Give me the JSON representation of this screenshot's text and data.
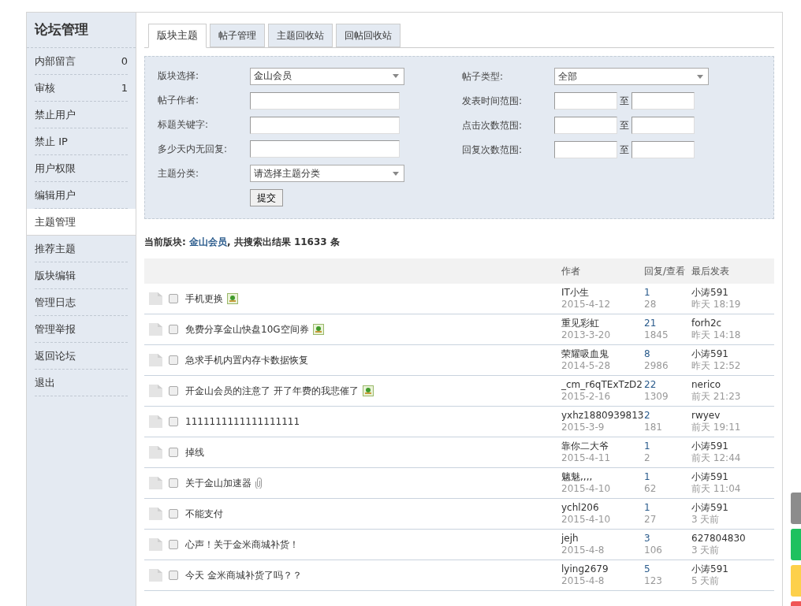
{
  "sidebar": {
    "title": "论坛管理",
    "items": [
      {
        "label": "内部留言",
        "count": "0",
        "selected": false
      },
      {
        "label": "审核",
        "count": "1",
        "selected": false
      },
      {
        "label": "禁止用户",
        "selected": false
      },
      {
        "label": "禁止 IP",
        "selected": false
      },
      {
        "label": "用户权限",
        "selected": false
      },
      {
        "label": "编辑用户",
        "selected": false
      },
      {
        "label": "主题管理",
        "selected": true
      },
      {
        "label": "推荐主题",
        "selected": false
      },
      {
        "label": "版块编辑",
        "selected": false
      },
      {
        "label": "管理日志",
        "selected": false
      },
      {
        "label": "管理举报",
        "selected": false
      },
      {
        "label": "返回论坛",
        "selected": false
      },
      {
        "label": "退出",
        "selected": false
      }
    ]
  },
  "tabs": [
    {
      "label": "版块主题",
      "selected": true
    },
    {
      "label": "帖子管理",
      "selected": false
    },
    {
      "label": "主题回收站",
      "selected": false
    },
    {
      "label": "回帖回收站",
      "selected": false
    }
  ],
  "filters": {
    "left": [
      {
        "label": "版块选择:",
        "kind": "select",
        "value": "金山会员"
      },
      {
        "label": "帖子作者:",
        "kind": "input"
      },
      {
        "label": "标题关键字:",
        "kind": "input"
      },
      {
        "label": "多少天内无回复:",
        "kind": "input"
      },
      {
        "label": "主题分类:",
        "kind": "select",
        "value": "请选择主题分类"
      }
    ],
    "right": [
      {
        "label": "帖子类型:",
        "kind": "select",
        "value": "全部"
      },
      {
        "label": "发表时间范围:",
        "kind": "range",
        "separator": "至"
      },
      {
        "label": "点击次数范围:",
        "kind": "range",
        "separator": "至"
      },
      {
        "label": "回复次数范围:",
        "kind": "range",
        "separator": "至"
      }
    ],
    "submit": "提交"
  },
  "summary": {
    "prefix": "当前版块:",
    "forum": "金山会员",
    "text": ", 共搜索出结果",
    "count": "11633",
    "unit": "条"
  },
  "table": {
    "columns": [
      "作者",
      "回复/查看",
      "最后发表"
    ],
    "rows": [
      {
        "title": "手机更换",
        "kind": "image",
        "checked": false,
        "author": "IT小生",
        "date": "2015-4-12",
        "replies": "1",
        "views": "28",
        "last_user": "小涛591",
        "last_time": "昨天 18:19"
      },
      {
        "title": "免费分享金山快盘10G空间券",
        "kind": "image",
        "checked": false,
        "author": "重见彩虹",
        "date": "2013-3-20",
        "replies": "21",
        "views": "1845",
        "last_user": "forh2c",
        "last_time": "昨天 14:18"
      },
      {
        "title": "急求手机内置内存卡数据恢复",
        "checked": false,
        "author": "荣耀吸血鬼",
        "date": "2014-5-28",
        "replies": "8",
        "views": "2986",
        "last_user": "小涛591",
        "last_time": "昨天 12:52"
      },
      {
        "title": "开金山会员的注意了 开了年费的我悲催了",
        "kind": "image",
        "checked": false,
        "author": "_cm_r6qTExTzD2",
        "date": "2015-2-16",
        "replies": "22",
        "views": "1309",
        "last_user": "nerico",
        "last_time": "前天 21:23"
      },
      {
        "title": "1111111111111111111",
        "checked": false,
        "author": "yxhz1880939813",
        "date": "2015-3-9",
        "replies": "2",
        "views": "181",
        "last_user": "rwyev",
        "last_time": "前天 19:11"
      },
      {
        "title": "掉线",
        "checked": false,
        "author": "靠你二大爷",
        "date": "2015-4-11",
        "replies": "1",
        "views": "2",
        "last_user": "小涛591",
        "last_time": "前天 12:44"
      },
      {
        "title": "关于金山加速器",
        "kind": "clip",
        "checked": false,
        "author": "魑魅,,,,",
        "date": "2015-4-10",
        "replies": "1",
        "views": "62",
        "last_user": "小涛591",
        "last_time": "前天 11:04"
      },
      {
        "title": "不能支付",
        "checked": false,
        "author": "ychl206",
        "date": "2015-4-10",
        "replies": "1",
        "views": "27",
        "last_user": "小涛591",
        "last_time": "3 天前"
      },
      {
        "title": "心声！关于金米商城补货！",
        "checked": false,
        "author": "jejh",
        "date": "2015-4-8",
        "replies": "3",
        "views": "106",
        "last_user": "627804830",
        "last_time": "3 天前"
      },
      {
        "title": "今天 金米商城补货了吗？？",
        "checked": false,
        "author": "lying2679",
        "date": "2015-4-8",
        "replies": "5",
        "views": "123",
        "last_user": "小涛591",
        "last_time": "5 天前"
      }
    ]
  },
  "side_buttons": [
    {
      "color": "#8c8c8c"
    },
    {
      "color": "#1ec15f"
    },
    {
      "color": "#fdd04a"
    },
    {
      "color": "#f05555"
    }
  ]
}
